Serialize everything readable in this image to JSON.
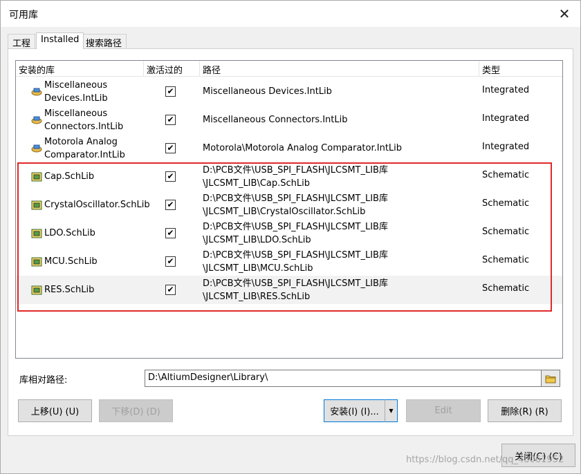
{
  "window": {
    "title": "可用库",
    "close_glyph": "✕"
  },
  "tabs": [
    {
      "label": "工程",
      "active": false
    },
    {
      "label": "Installed",
      "active": true
    },
    {
      "label": "搜索路径",
      "active": false
    }
  ],
  "list": {
    "columns": [
      "安装的库",
      "激活过的",
      "路径",
      "类型"
    ],
    "rows": [
      {
        "name": "Miscellaneous Devices.IntLib",
        "active": true,
        "path": "Miscellaneous Devices.IntLib",
        "type": "Integrated",
        "icon": "integrated-library-icon"
      },
      {
        "name": "Miscellaneous Connectors.IntLib",
        "active": true,
        "path": "Miscellaneous Connectors.IntLib",
        "type": "Integrated",
        "icon": "integrated-library-icon"
      },
      {
        "name": "Motorola Analog Comparator.IntLib",
        "active": true,
        "path": "Motorola\\Motorola Analog Comparator.IntLib",
        "type": "Integrated",
        "icon": "integrated-library-icon"
      },
      {
        "name": "Cap.SchLib",
        "active": true,
        "path": "D:\\PCB文件\\USB_SPI_FLASH\\JLCSMT_LIB库\\JLCSMT_LIB\\Cap.SchLib",
        "type": "Schematic",
        "icon": "schematic-library-icon"
      },
      {
        "name": "CrystalOscillator.SchLib",
        "active": true,
        "path": "D:\\PCB文件\\USB_SPI_FLASH\\JLCSMT_LIB库\\JLCSMT_LIB\\CrystalOscillator.SchLib",
        "type": "Schematic",
        "icon": "schematic-library-icon"
      },
      {
        "name": "LDO.SchLib",
        "active": true,
        "path": "D:\\PCB文件\\USB_SPI_FLASH\\JLCSMT_LIB库\\JLCSMT_LIB\\LDO.SchLib",
        "type": "Schematic",
        "icon": "schematic-library-icon"
      },
      {
        "name": "MCU.SchLib",
        "active": true,
        "path": "D:\\PCB文件\\USB_SPI_FLASH\\JLCSMT_LIB库\\JLCSMT_LIB\\MCU.SchLib",
        "type": "Schematic",
        "icon": "schematic-library-icon"
      },
      {
        "name": "RES.SchLib",
        "active": true,
        "path": "D:\\PCB文件\\USB_SPI_FLASH\\JLCSMT_LIB库\\JLCSMT_LIB\\RES.SchLib",
        "type": "Schematic",
        "icon": "schematic-library-icon"
      }
    ]
  },
  "relative_path": {
    "label": "库相对路径:",
    "value": "D:\\AltiumDesigner\\Library\\"
  },
  "buttons": {
    "move_up": "上移(U) (U)",
    "move_down": "下移(D) (D)",
    "install": "安装(I) (I)...",
    "edit": "Edit",
    "remove": "删除(R) (R)",
    "close": "关闭(C) (C)"
  },
  "watermark": "https://blog.csdn.net/qq_43061952",
  "colors": {
    "highlight_box": "#e02828",
    "primary_border": "#0078d7"
  }
}
